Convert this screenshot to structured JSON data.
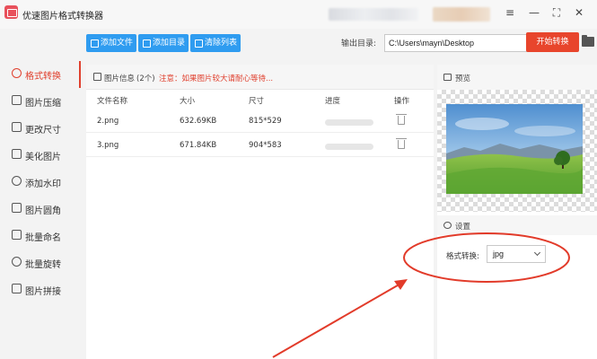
{
  "app": {
    "title": "优速图片格式转换器"
  },
  "window_controls": {
    "menu": "≡",
    "minimize": "—",
    "maximize": "⛶",
    "close": "✕"
  },
  "sidebar": {
    "items": [
      {
        "label": "格式转换",
        "icon": "format-convert-icon"
      },
      {
        "label": "图片压缩",
        "icon": "compress-icon"
      },
      {
        "label": "更改尺寸",
        "icon": "resize-icon"
      },
      {
        "label": "美化图片",
        "icon": "beautify-icon"
      },
      {
        "label": "添加水印",
        "icon": "watermark-icon"
      },
      {
        "label": "图片圆角",
        "icon": "round-corner-icon"
      },
      {
        "label": "批量命名",
        "icon": "rename-icon"
      },
      {
        "label": "批量旋转",
        "icon": "rotate-icon"
      },
      {
        "label": "图片拼接",
        "icon": "stitch-icon"
      }
    ],
    "active_index": 0
  },
  "toolbar": {
    "add_file": "添加文件",
    "add_folder": "添加目录",
    "clear_list": "清除列表",
    "output_label": "输出目录:",
    "output_path": "C:\\Users\\mayn\\Desktop",
    "more": "···",
    "start": "开始转换"
  },
  "file_list": {
    "info_label": "图片信息",
    "info_count": "(2个)",
    "info_note": "注意：如果图片较大请耐心等待...",
    "columns": [
      "文件名称",
      "大小",
      "尺寸",
      "进度",
      "操作"
    ],
    "rows": [
      {
        "name": "2.png",
        "size": "632.69KB",
        "dims": "815*529",
        "progress": 0
      },
      {
        "name": "3.png",
        "size": "671.84KB",
        "dims": "904*583",
        "progress": 0
      }
    ]
  },
  "preview": {
    "label": "预览"
  },
  "settings": {
    "label": "设置",
    "format_label": "格式转换:",
    "format_value": "jpg"
  },
  "colors": {
    "accent": "#e0402e",
    "primary_button": "#2f9cf0",
    "start_button": "#e8452c",
    "annotation": "#e23b2a"
  }
}
